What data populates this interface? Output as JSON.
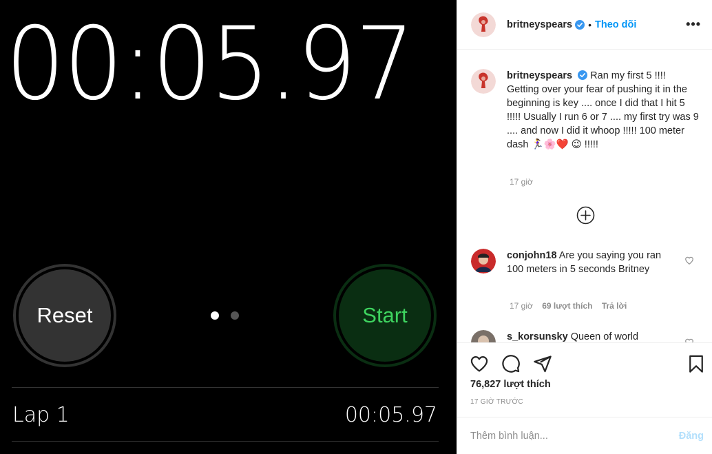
{
  "stopwatch": {
    "main_time": "00:05.97",
    "reset_label": "Reset",
    "start_label": "Start",
    "lap_label": "Lap 1",
    "lap_time": "00:05.97"
  },
  "post": {
    "username": "britneyspears",
    "follow_label": "Theo dõi",
    "dot_separator": "•",
    "more_label": "•••",
    "caption_text": "Ran my first 5 !!!! Getting over your fear of pushing it in the beginning is key .... once I did that I hit 5 !!!!! Usually I run 6 or 7 .... my first try was 9 .... and now I did it whoop !!!!! 100 meter dash 🏃‍♀️🌸❤️ 😉 !!!!!",
    "caption_time": "17 giờ",
    "likes": "76,827 lượt thích",
    "posted_time": "17 GIỜ TRƯỚC",
    "add_comment_placeholder": "Thêm bình luận...",
    "post_button": "Đăng"
  },
  "comments": [
    {
      "username": "conjohn18",
      "text": "Are you saying you ran 100 meters in 5 seconds Britney",
      "time": "17 giờ",
      "likes": "69 lượt thích",
      "reply": "Trả lời"
    },
    {
      "username": "s_korsunsky",
      "text": "Queen of world"
    }
  ],
  "colors": {
    "accent": "#0095f6",
    "start_green": "#3ed35f",
    "post_disabled": "#b2dffc"
  }
}
